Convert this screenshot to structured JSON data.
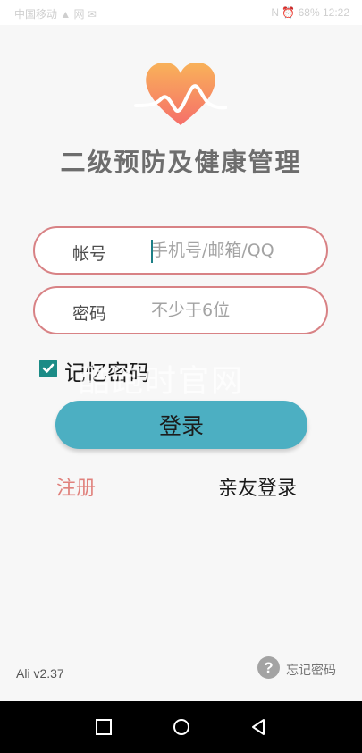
{
  "status_bar": {
    "left": "中国移动 ▲ 网 ✉",
    "right": "N ⏰ 68% 12:22"
  },
  "logo": {
    "icon": "heart-pulse-icon",
    "colors": [
      "#f8b259",
      "#f66f6a",
      "#ffffff"
    ]
  },
  "title": "二级预防及健康管理",
  "account": {
    "label": "帐号",
    "placeholder": "手机号/邮箱/QQ",
    "value": ""
  },
  "password": {
    "label": "密码",
    "placeholder": "不少于6位",
    "value": ""
  },
  "remember_password": {
    "label": "记忆密码",
    "checked": true
  },
  "watermark": "酷跑时官网",
  "login_button": "登录",
  "register_link": "注册",
  "family_login_link": "亲友登录",
  "version": "Ali v2.37",
  "forgot_password": "忘记密码",
  "navigation": {
    "recent": "square-icon",
    "home": "circle-icon",
    "back": "triangle-back-icon"
  },
  "colors": {
    "accent": "#4cafc2",
    "border": "#d88285",
    "register": "#e0817c",
    "checkbox": "#1b8b86"
  }
}
